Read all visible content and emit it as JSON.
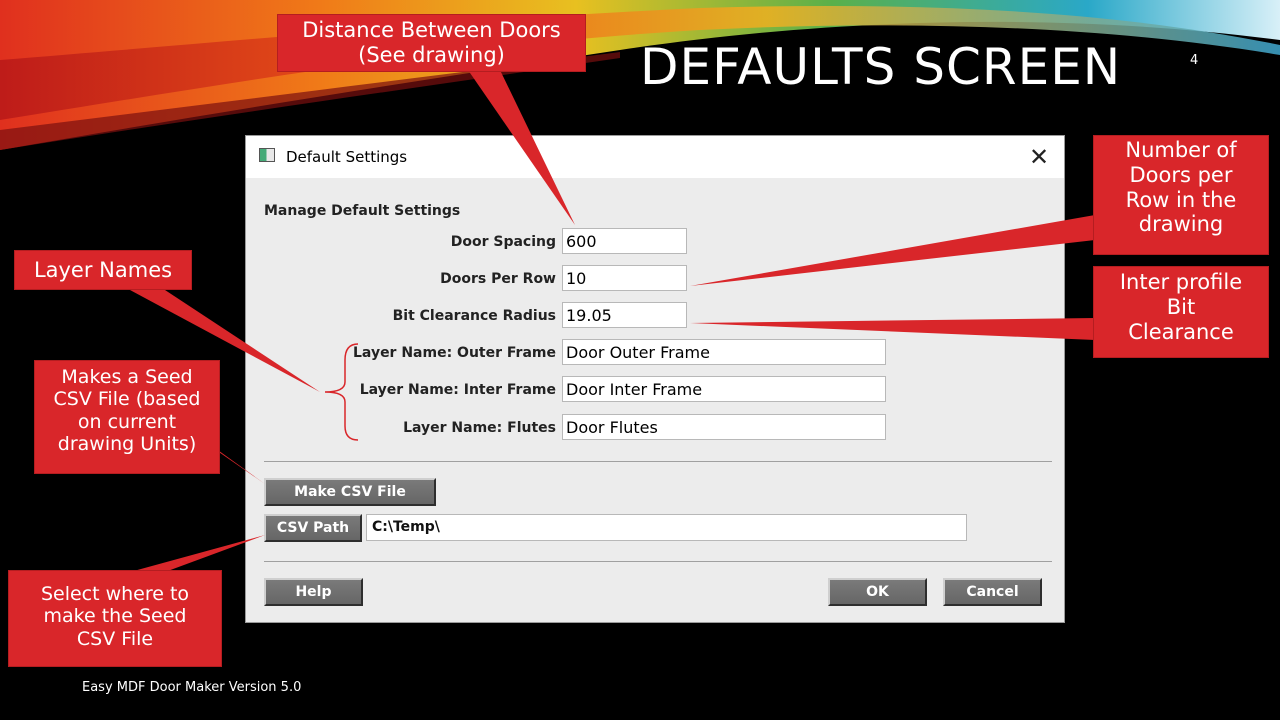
{
  "slide": {
    "title": "DEFAULTS SCREEN",
    "number": "4",
    "footer": "Easy MDF Door Maker Version 5.0"
  },
  "dialog": {
    "title": "Default Settings",
    "close_glyph": "✕",
    "section_label": "Manage Default Settings",
    "fields": [
      {
        "label": "Door Spacing",
        "value": "600"
      },
      {
        "label": "Doors Per Row",
        "value": "10"
      },
      {
        "label": "Bit Clearance Radius",
        "value": "19.05"
      },
      {
        "label": "Layer Name: Outer Frame",
        "value": "Door Outer Frame"
      },
      {
        "label": "Layer Name: Inter Frame",
        "value": "Door Inter Frame"
      },
      {
        "label": "Layer Name: Flutes",
        "value": "Door Flutes"
      }
    ],
    "make_csv_label": "Make CSV File",
    "csv_path_label": "CSV Path",
    "csv_path_value": "C:\\Temp\\",
    "help_label": "Help",
    "ok_label": "OK",
    "cancel_label": "Cancel"
  },
  "callouts": {
    "distance_line1": "Distance Between Doors",
    "distance_line2": "(See drawing)",
    "layer_names": "Layer Names",
    "doors_per_row_l1": "Number of",
    "doors_per_row_l2": "Doors per",
    "doors_per_row_l3": "Row in the",
    "doors_per_row_l4": "drawing",
    "inter_l1": "Inter profile",
    "inter_l2": "Bit",
    "inter_l3": "Clearance",
    "seed_l1": "Makes a Seed",
    "seed_l2": "CSV File (based",
    "seed_l3": "on current",
    "seed_l4": "drawing Units)",
    "select_l1": "Select where to",
    "select_l2": "make the Seed",
    "select_l3": "CSV File"
  },
  "colors": {
    "callout_red": "#d9262a",
    "background": "#000000",
    "dialog_bg": "#ececec",
    "button_gray": "#6e6e6e"
  }
}
